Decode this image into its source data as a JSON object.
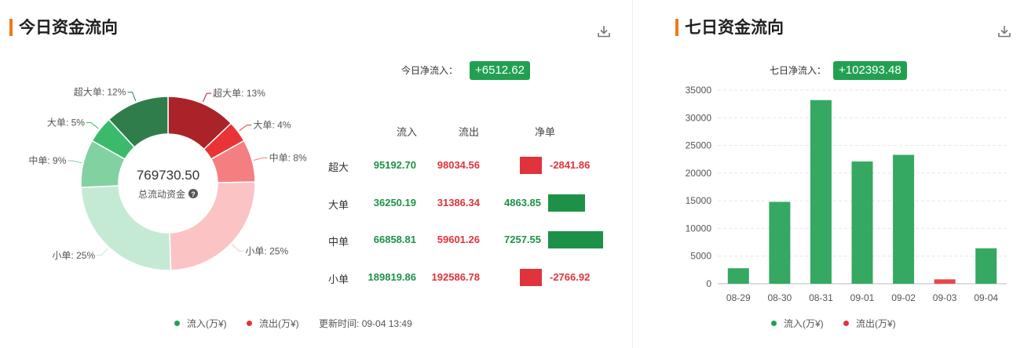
{
  "left_panel": {
    "title": "今日资金流向",
    "download_icon": "download-icon",
    "net_inflow_label": "今日净流入：",
    "net_inflow_value": "+6512.62",
    "donut_center_value": "769730.50",
    "donut_center_label": "总流动资金",
    "table_headers": {
      "in": "流入",
      "out": "流出",
      "net": "净单"
    },
    "rows": [
      {
        "label": "超大",
        "in": "95192.70",
        "out": "98034.56",
        "net": "-2841.86"
      },
      {
        "label": "大单",
        "in": "36250.19",
        "out": "31386.34",
        "net": "4863.85"
      },
      {
        "label": "中单",
        "in": "66858.81",
        "out": "59601.26",
        "net": "7257.55"
      },
      {
        "label": "小单",
        "in": "189819.86",
        "out": "192586.78",
        "net": "-2766.92"
      }
    ],
    "legend": {
      "in": "流入(万¥)",
      "out": "流出(万¥)",
      "update": "更新时间: 09-04 13:49"
    }
  },
  "right_panel": {
    "title": "七日资金流向",
    "download_icon": "download-icon",
    "net_inflow_label": "七日净流入：",
    "net_inflow_value": "+102393.48",
    "legend": {
      "in": "流入(万¥)",
      "out": "流出(万¥)"
    }
  },
  "colors": {
    "accent": "#f07a16",
    "inflow": "#22a052",
    "outflow": "#e0333c",
    "bar_green": "#35a862",
    "bar_red": "#e8474c"
  },
  "chart_data": [
    {
      "type": "pie",
      "donut": true,
      "center_text": "769730.50",
      "center_label": "总流动资金",
      "slices": [
        {
          "label": "超大单: 13%",
          "percent": 13,
          "flow": "out",
          "color": "#a92329"
        },
        {
          "label": "大单: 4%",
          "percent": 4,
          "flow": "out",
          "color": "#ea3336"
        },
        {
          "label": "中单: 8%",
          "percent": 8,
          "flow": "out",
          "color": "#f47f80"
        },
        {
          "label": "小单: 25%",
          "percent": 25,
          "flow": "out",
          "color": "#fbc3c4"
        },
        {
          "label": "小单: 25%",
          "percent": 25,
          "flow": "in",
          "color": "#c5ead4"
        },
        {
          "label": "中单: 9%",
          "percent": 9,
          "flow": "in",
          "color": "#82d1a1"
        },
        {
          "label": "大单: 5%",
          "percent": 5,
          "flow": "in",
          "color": "#3cba6c"
        },
        {
          "label": "超大单: 12%",
          "percent": 12,
          "flow": "in",
          "color": "#2f7d4b"
        }
      ]
    },
    {
      "type": "bar",
      "categories": [
        "08-29",
        "08-30",
        "08-31",
        "09-01",
        "09-02",
        "09-03",
        "09-04"
      ],
      "values": [
        2800,
        14800,
        33200,
        22100,
        23300,
        -800,
        6400
      ],
      "ylim": [
        0,
        35000
      ],
      "yticks": [
        0,
        5000,
        10000,
        15000,
        20000,
        25000,
        30000,
        35000
      ],
      "grid": true,
      "legend_position": "bottom",
      "xlabel": "",
      "ylabel": ""
    }
  ]
}
